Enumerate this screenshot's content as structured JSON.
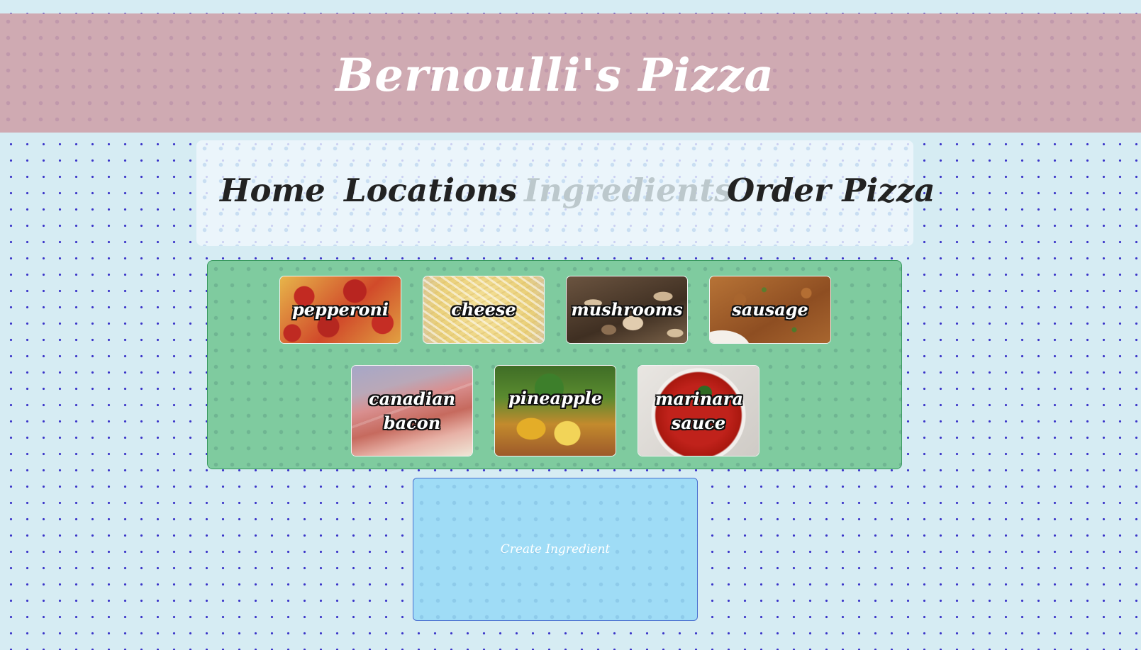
{
  "site": {
    "title": "Bernoulli's Pizza"
  },
  "nav": {
    "items": [
      {
        "label": "Home",
        "active": false
      },
      {
        "label": "Locations",
        "active": false
      },
      {
        "label": "Ingredients",
        "active": true
      },
      {
        "label": "Order Pizza",
        "active": false
      }
    ]
  },
  "ingredients": [
    {
      "name": "pepperoni"
    },
    {
      "name": "cheese"
    },
    {
      "name": "mushrooms"
    },
    {
      "name": "sausage"
    },
    {
      "name": "canadian bacon"
    },
    {
      "name": "pineapple"
    },
    {
      "name": "marinara sauce"
    }
  ],
  "actions": {
    "create_label": "Create Ingredient"
  },
  "colors": {
    "page_background": "#d6ecf3",
    "banner": "#cfaab2",
    "panel": "#7fcb9f",
    "create_button": "#9fdcf6",
    "nav_active": "#bcc8cc",
    "nav_text": "#222222"
  }
}
